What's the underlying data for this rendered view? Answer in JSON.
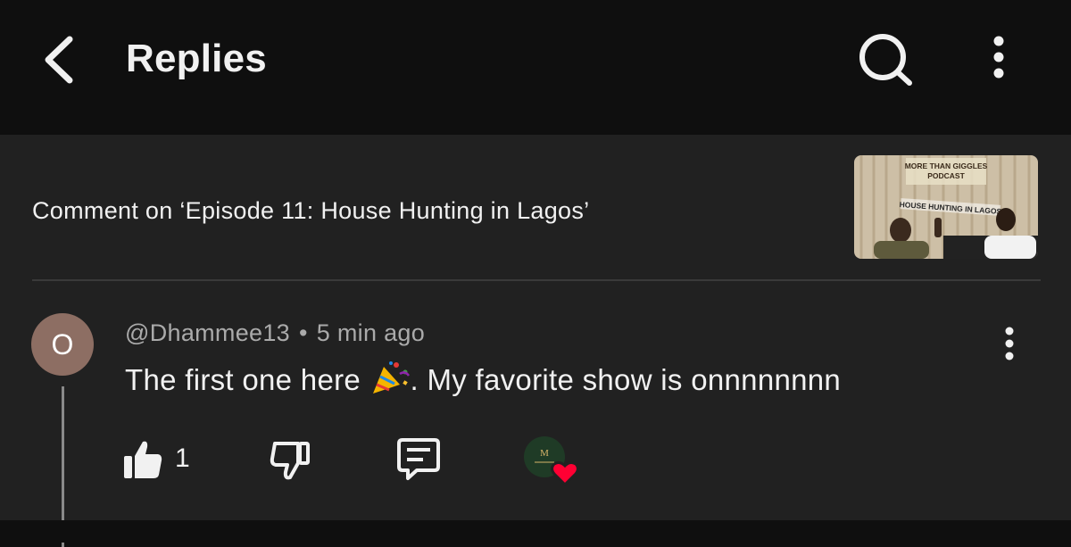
{
  "header": {
    "title": "Replies",
    "back_icon": "arrow-back-icon",
    "search_icon": "search-icon",
    "more_icon": "more-vertical-icon"
  },
  "video_context": {
    "text": "Comment on ‘Episode 11: House Hunting in Lagos’",
    "thumbnail": {
      "line1": "MORE THAN GIGGLES",
      "line2": "PODCAST",
      "banner": "HOUSE HUNTING IN LAGOS"
    }
  },
  "comment": {
    "avatar_letter": "O",
    "avatar_color": "#8d6e63",
    "author": "@Dhammee13",
    "separator": "•",
    "time": "5 min ago",
    "text_before_emoji": "The first one here ",
    "emoji": "party-popper-icon",
    "text_after_emoji": ". My favorite show is onnnnnnnn",
    "like_count": "1",
    "hearted_by_creator": true,
    "heart_color": "#ff0033"
  },
  "colors": {
    "background": "#0f0f0f",
    "panel": "#212121",
    "text": "#f1f1f1",
    "secondary_text": "#aaaaaa"
  }
}
